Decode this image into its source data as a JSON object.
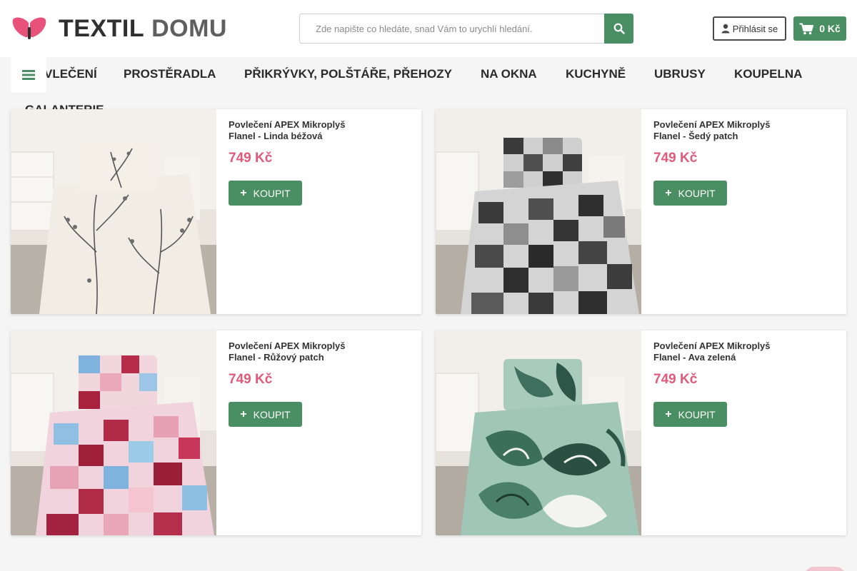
{
  "logo": {
    "word1": "TEXTIL",
    "word2": "DOMU"
  },
  "search": {
    "placeholder": "Zde napište co hledáte, snad Vám to urychlí hledání."
  },
  "login": {
    "label": "Přihlásit se"
  },
  "cart": {
    "label": "0 Kč"
  },
  "nav": {
    "items": [
      {
        "label": "VLEČENÍ"
      },
      {
        "label": "PROSTĚRADLA"
      },
      {
        "label": "PŘIKRÝVKY, POLŠTÁŘE, PŘEHOZY"
      },
      {
        "label": "NA OKNA"
      },
      {
        "label": "KUCHYNĚ"
      },
      {
        "label": "UBRUSY"
      },
      {
        "label": "KOUPELNA"
      },
      {
        "label": "GALANTERIE"
      }
    ]
  },
  "products": [
    {
      "title": "Povlečení APEX Mikroplyš Flanel - Linda béžová",
      "price": "749 Kč",
      "buy": "KOUPIT"
    },
    {
      "title": "Povlečení APEX Mikroplyš Flanel - Šedý patch",
      "price": "749 Kč",
      "buy": "KOUPIT"
    },
    {
      "title": "Povlečení APEX Mikroplyš Flanel - Růžový patch",
      "price": "749 Kč",
      "buy": "KOUPIT"
    },
    {
      "title": "Povlečení APEX Mikroplyš Flanel - Ava zelená",
      "price": "749 Kč",
      "buy": "KOUPIT"
    }
  ],
  "colors": {
    "accent": "#4a8f63",
    "price": "#e05a7a",
    "logo_pink": "#e8527a"
  },
  "icons": {
    "search": "search-icon",
    "user": "user-icon",
    "cart": "cart-icon",
    "menu": "hamburger-icon",
    "plus": "plus-icon"
  }
}
